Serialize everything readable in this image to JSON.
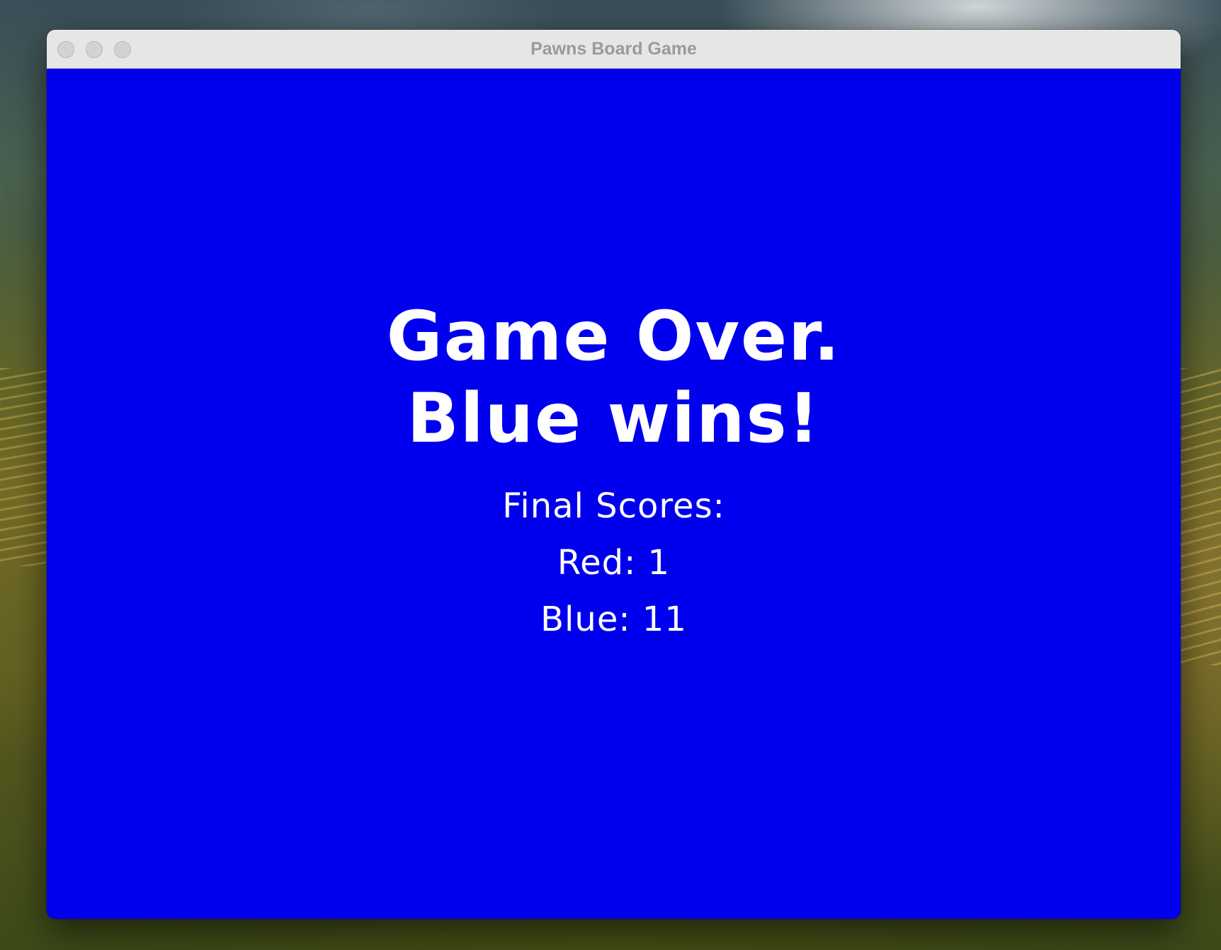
{
  "window": {
    "title": "Pawns Board Game"
  },
  "game_over": {
    "line1": "Game Over.",
    "line2": "Blue wins!",
    "final_scores_label": "Final Scores:",
    "red_score": "Red: 1",
    "blue_score": "Blue: 11"
  },
  "colors": {
    "background": "#0000ee",
    "text": "#ffffff",
    "titlebar": "#e6e6e4"
  }
}
